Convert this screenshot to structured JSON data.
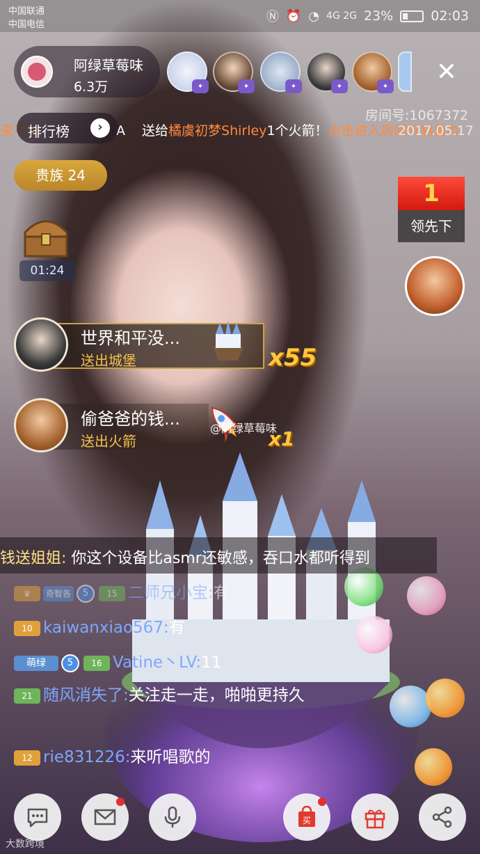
{
  "status_bar": {
    "carrier1": "中国联通",
    "carrier2": "中国电信",
    "network": "4G 2G",
    "battery": "23%",
    "time": "02:03"
  },
  "host": {
    "name": "阿绿草莓味",
    "fans": "6.3万"
  },
  "ticker": {
    "part1": "来不再",
    "part2": "A",
    "part3": "送给",
    "part4": "橘虞初梦Shirley",
    "part5": "1个火箭！",
    "part6": "点击进入房间开启鱼丸"
  },
  "rank_button": {
    "label": "排行榜",
    "chevron": "›"
  },
  "room": {
    "id": "房间号:1067372",
    "date": "2017.05.17"
  },
  "noble": {
    "label": "贵族 24"
  },
  "chest": {
    "timer": "01:24"
  },
  "leader": {
    "rank": "1",
    "label": "领先下"
  },
  "gifts": [
    {
      "name": "世界和平没...",
      "action": "送出城堡",
      "count": "x55"
    },
    {
      "name": "偷爸爸的钱...",
      "action": "送出火箭",
      "count": "x1"
    }
  ],
  "watermark": "@阿绿草莓味",
  "chat_top": {
    "user": "钱送姐姐:",
    "message": " 你这个设备比asmr还敏感，吞口水都听得到"
  },
  "chat": [
    {
      "badge": "奇智各",
      "level_circle": "5",
      "level": "15",
      "user": "二师兄小宝:",
      "message": "有"
    },
    {
      "level": "10",
      "user": "kaiwanxiao567:",
      "message": "有"
    },
    {
      "badge": "萌绿",
      "level_circle": "5",
      "level": "16",
      "user": "Vatine丶LV:",
      "message": "11"
    },
    {
      "level": "21",
      "user": "随风消失了:",
      "message": "关注走一走，啪啪更持久"
    },
    {
      "level": "12",
      "user": "rie831226:",
      "message": "来听唱歌的"
    }
  ],
  "footer": "大数跨境",
  "icons": {
    "chat": "chat-bubble-icon",
    "mail": "envelope-icon",
    "voice": "microphone-icon",
    "shop": "shopping-bag-icon",
    "gift": "gift-icon",
    "share": "share-icon",
    "close": "close-icon"
  },
  "colors": {
    "accent_orange": "#ff8a3d",
    "gift_gold": "#ffc83a",
    "username_blue": "#7ea7ff",
    "noble_gold": "#d9a73c",
    "leader_red": "#e22a1c"
  }
}
